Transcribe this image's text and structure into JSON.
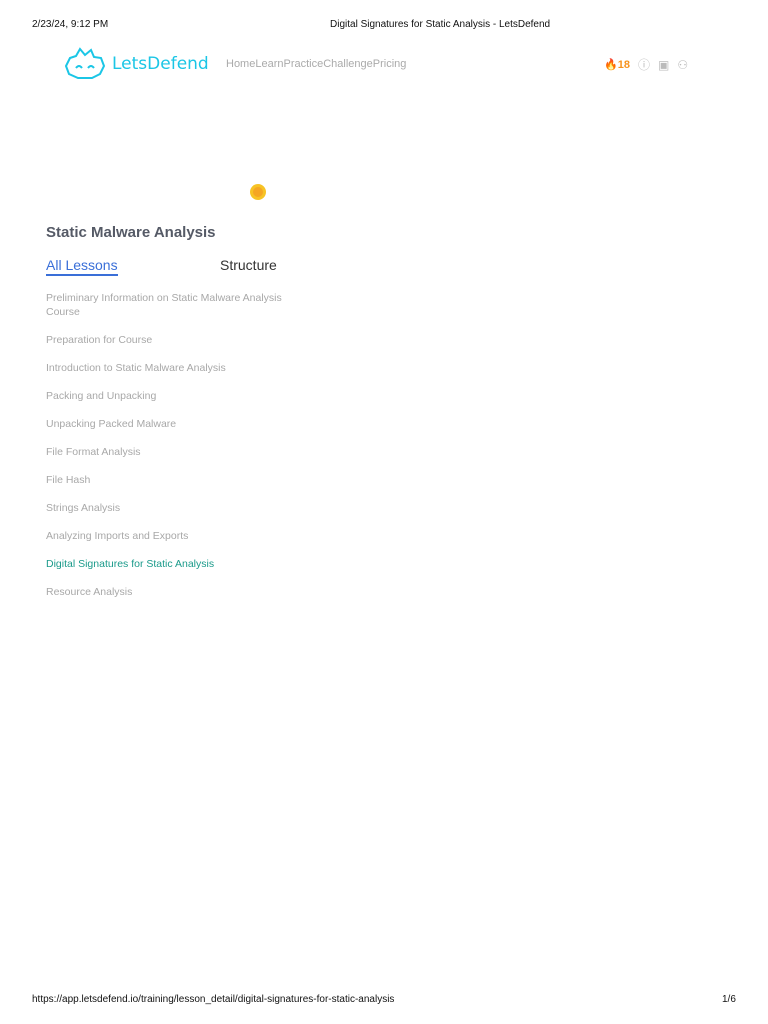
{
  "print_header": {
    "datetime": "2/23/24, 9:12 PM",
    "title": "Digital Signatures for Static Analysis - LetsDefend"
  },
  "brand": "LetsDefend",
  "nav": [
    "Home",
    "Learn",
    "Practice",
    "Challenge",
    "Pricing"
  ],
  "streak": "18",
  "course_title": "Static Malware Analysis",
  "tabs": {
    "all": "All Lessons",
    "structure": "Structure"
  },
  "lessons": [
    "Preliminary Information on Static Malware Analysis Course",
    "Preparation for Course",
    "Introduction to Static Malware Analysis",
    "Packing and Unpacking",
    "Unpacking Packed Malware",
    "File Format Analysis",
    "File Hash",
    "Strings Analysis",
    "Analyzing Imports and Exports",
    "Digital Signatures for Static Analysis",
    "Resource Analysis"
  ],
  "active_lesson": 9,
  "print_footer": {
    "url": "https://app.letsdefend.io/training/lesson_detail/digital-signatures-for-static-analysis",
    "page": "1/6"
  }
}
